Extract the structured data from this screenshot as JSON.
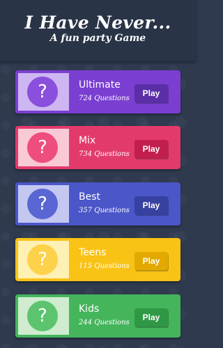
{
  "header": {
    "title": "I Have Never...",
    "subtitle": "A fun party Game"
  },
  "categories": [
    {
      "name": "Ultimate",
      "count": "724 Questions",
      "play_label": "Play",
      "icon": "question-mark-icon",
      "light": "#cdb6f1",
      "main": "#7a3fd1",
      "circle": "#8a4fdc",
      "button": "#5b2ea8"
    },
    {
      "name": "Mix",
      "count": "734 Questions",
      "play_label": "Play",
      "icon": "question-mark-icon",
      "light": "#f9c9d6",
      "main": "#e33a6c",
      "circle": "#ee4e7e",
      "button": "#c21f4e"
    },
    {
      "name": "Best",
      "count": "357 Questions",
      "play_label": "Play",
      "icon": "question-mark-icon",
      "light": "#c4c8f1",
      "main": "#4b56c8",
      "circle": "#5a66d3",
      "button": "#3741a0"
    },
    {
      "name": "Teens",
      "count": "115 Questions",
      "play_label": "Play",
      "icon": "question-mark-icon",
      "light": "#fff0b3",
      "main": "#f9c316",
      "circle": "#fdd24a",
      "button": "#e3a900"
    },
    {
      "name": "Kids",
      "count": "244 Questions",
      "play_label": "Play",
      "icon": "question-mark-icon",
      "light": "#cfeccf",
      "main": "#45b55c",
      "circle": "#5cc46f",
      "button": "#2f9845"
    }
  ]
}
